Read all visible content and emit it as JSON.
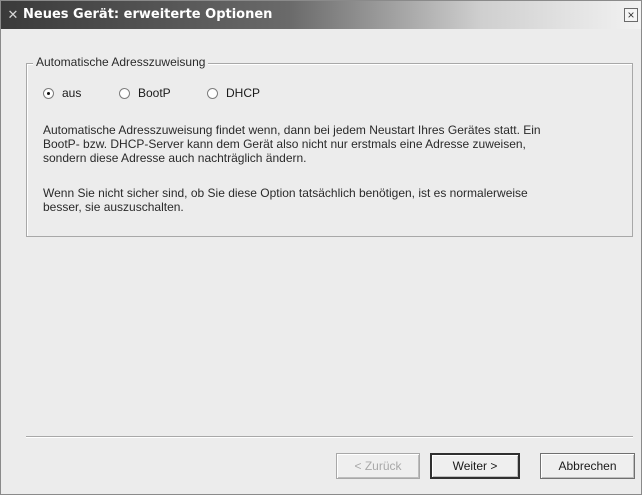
{
  "window": {
    "title": "Neues Gerät: erweiterte Optionen",
    "close_label": "×"
  },
  "group": {
    "legend": "Automatische Adresszuweisung",
    "options": [
      {
        "label": "aus",
        "checked": true
      },
      {
        "label": "BootP",
        "checked": false
      },
      {
        "label": "DHCP",
        "checked": false
      }
    ],
    "description_1": [
      "Automatische Adresszuweisung findet wenn, dann bei jedem Neustart Ihres Gerätes statt. Ein",
      "BootP- bzw. DHCP-Server kann dem Gerät also nicht nur erstmals eine Adresse zuweisen,",
      "sondern diese Adresse auch nachträglich ändern."
    ],
    "description_2": [
      "Wenn Sie nicht sicher sind, ob Sie diese Option tatsächlich benötigen, ist es normalerweise",
      "besser, sie auszuschalten."
    ]
  },
  "buttons": {
    "back": "< Zurück",
    "next": "Weiter >",
    "cancel": "Abbrechen"
  },
  "icons": {
    "title_icon": "app-icon",
    "close": "close-icon"
  }
}
